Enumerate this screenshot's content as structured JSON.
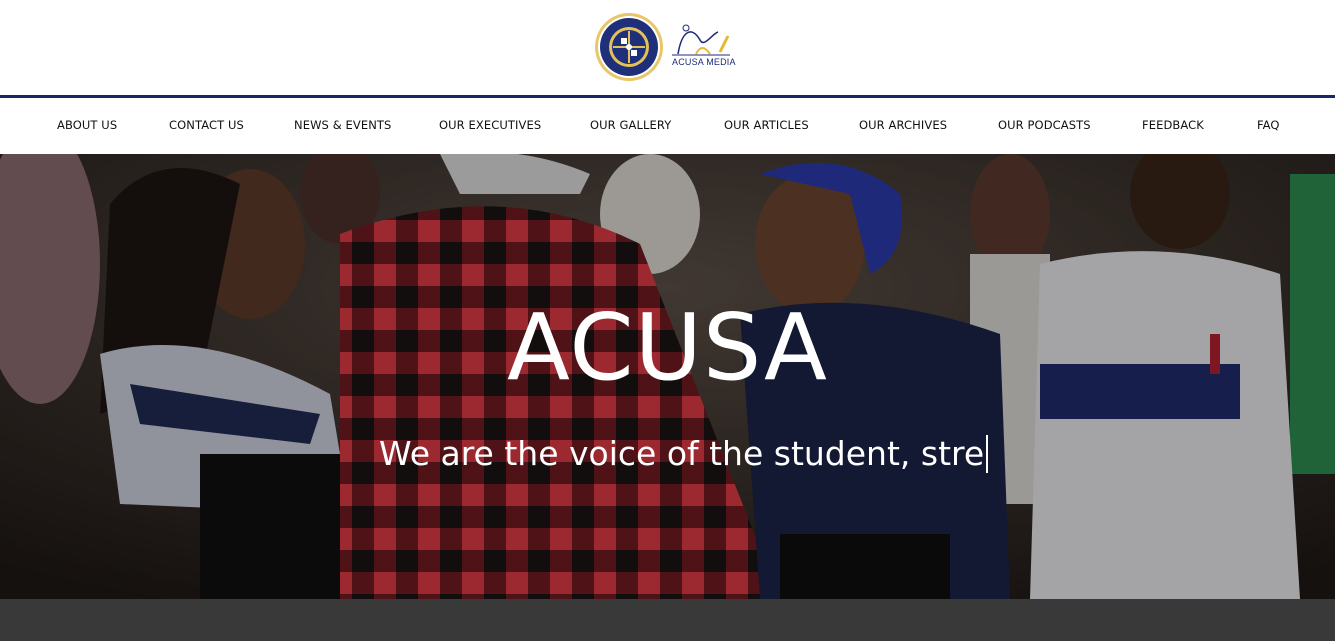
{
  "header": {
    "media_logo_text": "ACUSA MEDIA"
  },
  "nav": {
    "items": [
      {
        "label": "ABOUT US"
      },
      {
        "label": "CONTACT US"
      },
      {
        "label": "NEWS & EVENTS"
      },
      {
        "label": "OUR EXECUTIVES"
      },
      {
        "label": "OUR GALLERY"
      },
      {
        "label": "OUR ARTICLES"
      },
      {
        "label": "OUR ARCHIVES"
      },
      {
        "label": "OUR PODCASTS"
      },
      {
        "label": "FEEDBACK"
      },
      {
        "label": "FAQ"
      }
    ]
  },
  "hero": {
    "title": "ACUSA",
    "tagline": "We are the voice of the student, stre"
  },
  "colors": {
    "navy": "#1d2667",
    "nav_text": "#111111",
    "hero_text": "#ffffff",
    "bottom_band": "#393939"
  }
}
